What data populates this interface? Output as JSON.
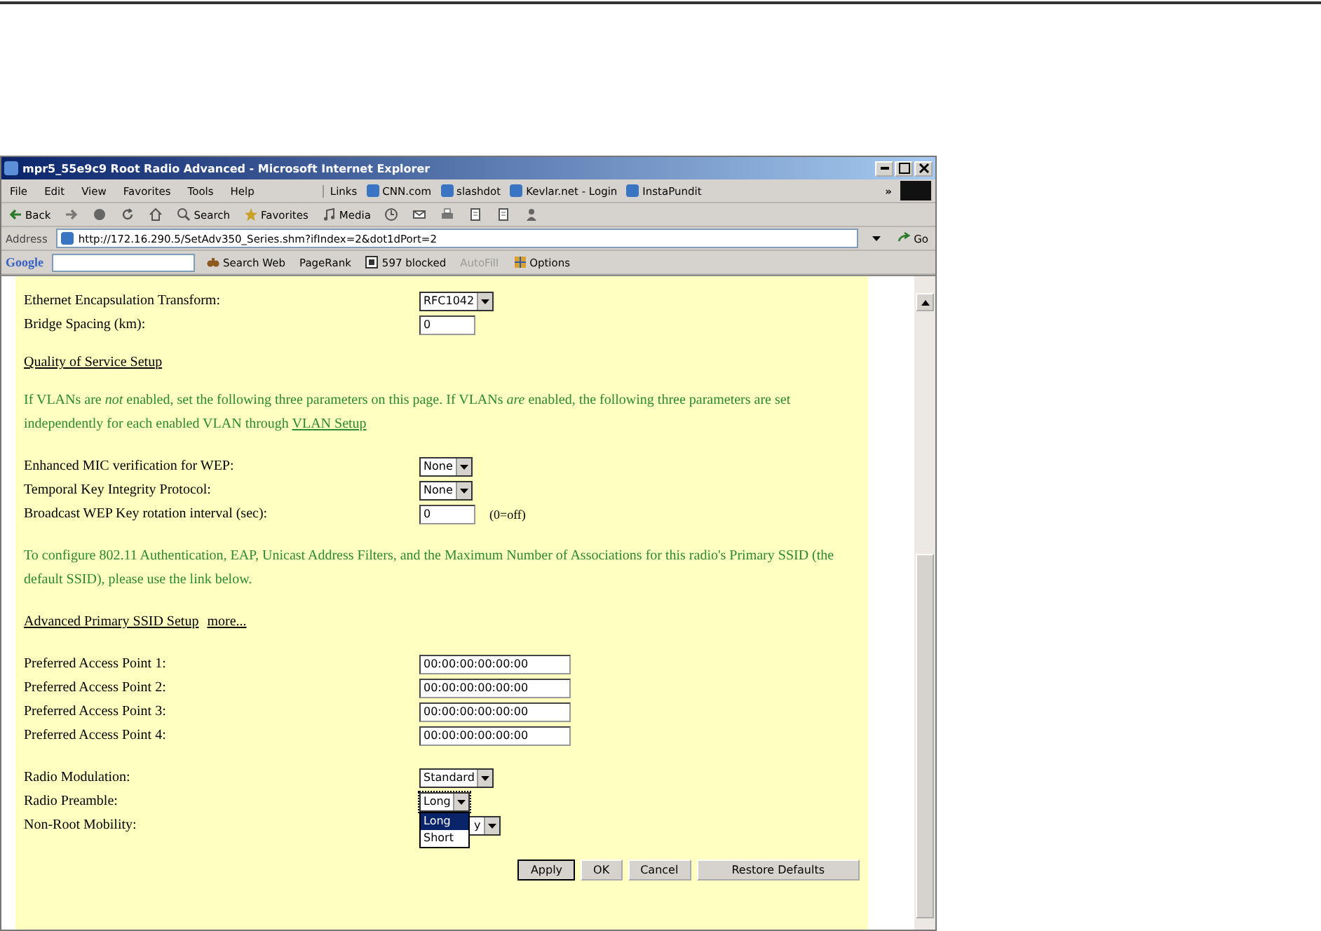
{
  "window": {
    "title": "mpr5_55e9c9 Root Radio Advanced - Microsoft Internet Explorer"
  },
  "menu": [
    "File",
    "Edit",
    "View",
    "Favorites",
    "Tools",
    "Help"
  ],
  "links_bar": {
    "label": "Links",
    "items": [
      "CNN.com",
      "slashdot",
      "Kevlar.net - Login",
      "InstaPundit"
    ],
    "more": "»"
  },
  "toolbar": [
    {
      "kind": "back",
      "label": "Back"
    },
    {
      "kind": "forward"
    },
    {
      "kind": "stop"
    },
    {
      "kind": "refresh"
    },
    {
      "kind": "home"
    },
    {
      "kind": "search",
      "label": "Search"
    },
    {
      "kind": "favorites",
      "label": "Favorites"
    },
    {
      "kind": "media",
      "label": "Media"
    },
    {
      "kind": "history"
    },
    {
      "kind": "mail"
    },
    {
      "kind": "print"
    },
    {
      "kind": "edit"
    },
    {
      "kind": "discuss"
    },
    {
      "kind": "messenger"
    }
  ],
  "address": {
    "label": "Address",
    "url": "http://172.16.290.5/SetAdv350_Series.shm?ifIndex=2&dot1dPort=2",
    "go": "Go"
  },
  "google_bar": {
    "logo": "Google",
    "search_web": "Search Web",
    "pagerank": "PageRank",
    "blocked": "597 blocked",
    "autofill": "AutoFill",
    "options": "Options"
  },
  "settings_top": [
    {
      "label": "Ethernet Encapsulation Transform:",
      "kind": "select",
      "value": "RFC1042"
    },
    {
      "label": "Bridge Spacing (km):",
      "kind": "input",
      "value": "0"
    }
  ],
  "qos_link": "Quality of Service Setup",
  "vlan_note": "If VLANs are *not* enabled, set the following three parameters on this page. If VLANs *are* enabled, the following three parameters are set independently for each enabled VLAN through",
  "vlan_link": "VLAN Setup",
  "settings_qos": [
    {
      "label": "Enhanced MIC verification for WEP:",
      "kind": "select",
      "value": "None"
    },
    {
      "label": "Temporal Key Integrity Protocol:",
      "kind": "select",
      "value": "None"
    },
    {
      "label": "Broadcast WEP Key rotation interval (sec):",
      "kind": "input",
      "value": "0",
      "hint": "(0=off)"
    }
  ],
  "ssid_note": "To configure 802.11 Authentication, EAP, Unicast Address Filters, and the Maximum Number of Associations for this radio's Primary SSID (the default SSID), please use the link below.",
  "ssid_link": "Advanced Primary SSID Setup",
  "more_link": "more...",
  "access_points": [
    {
      "label": "Preferred Access Point 1:",
      "value": "00:00:00:00:00:00"
    },
    {
      "label": "Preferred Access Point 2:",
      "value": "00:00:00:00:00:00"
    },
    {
      "label": "Preferred Access Point 3:",
      "value": "00:00:00:00:00:00"
    },
    {
      "label": "Preferred Access Point 4:",
      "value": "00:00:00:00:00:00"
    }
  ],
  "settings_radio": [
    {
      "label": "Radio Modulation:",
      "kind": "select",
      "value": "Standard"
    },
    {
      "label": "Radio Preamble:",
      "kind": "select",
      "value": "Long",
      "open": true
    },
    {
      "label": "Non-Root Mobility:",
      "kind": "select",
      "value": "y"
    }
  ],
  "dropdown_options": [
    {
      "label": "Long",
      "selected": true
    },
    {
      "label": "Short",
      "selected": false
    }
  ],
  "buttons": [
    "Apply",
    "OK",
    "Cancel",
    "Restore Defaults"
  ]
}
